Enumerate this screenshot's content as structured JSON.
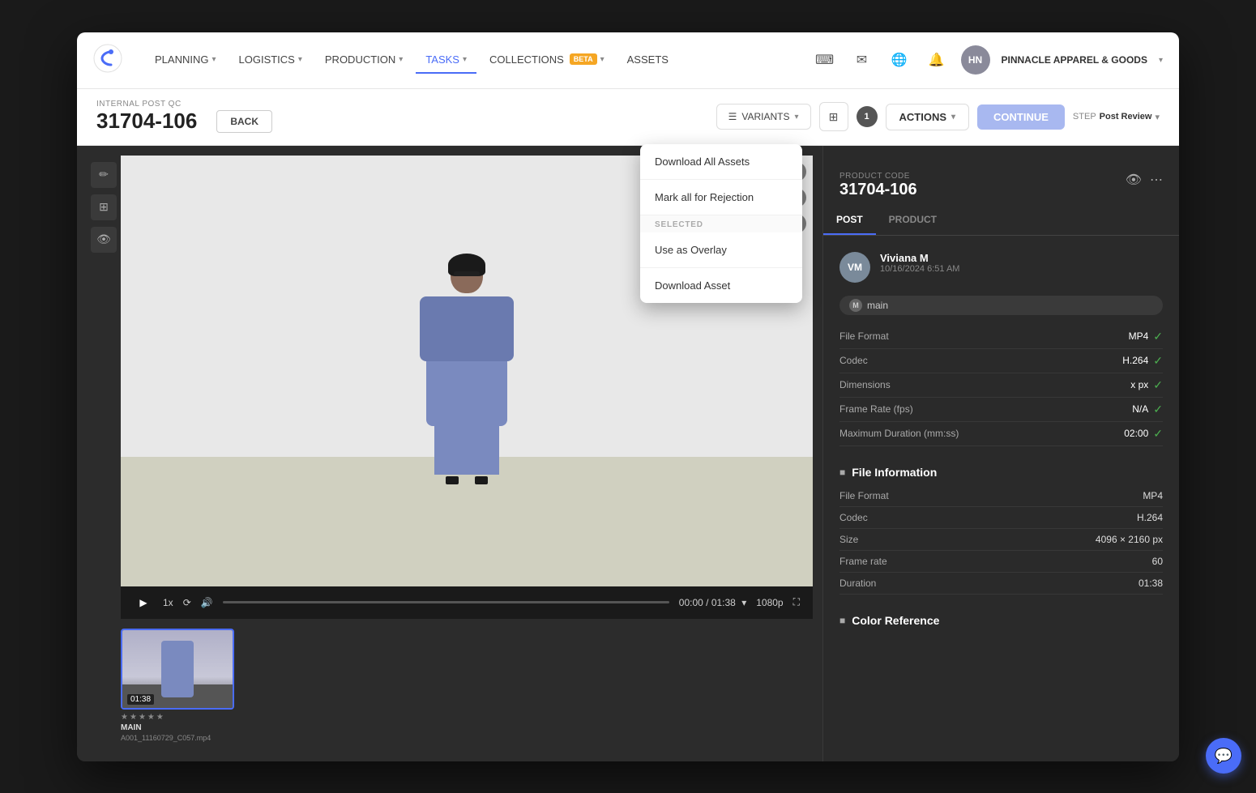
{
  "app": {
    "title": "Centric",
    "company": "PINNACLE APPAREL & GOODS"
  },
  "nav": {
    "items": [
      {
        "id": "planning",
        "label": "PLANNING",
        "hasChevron": true,
        "active": false
      },
      {
        "id": "logistics",
        "label": "LOGISTICS",
        "hasChevron": true,
        "active": false
      },
      {
        "id": "production",
        "label": "PRODUCTION",
        "hasChevron": true,
        "active": false
      },
      {
        "id": "tasks",
        "label": "TASKS",
        "hasChevron": true,
        "active": true
      },
      {
        "id": "collections",
        "label": "COLLECTIONS",
        "hasChevron": true,
        "active": false,
        "beta": true
      },
      {
        "id": "assets",
        "label": "ASSETS",
        "hasChevron": false,
        "active": false
      }
    ],
    "user_initials": "HN"
  },
  "subheader": {
    "label": "INTERNAL POST QC",
    "id": "31704-106",
    "back_label": "BACK",
    "variants_label": "VARIANTS",
    "actions_label": "ACTIONS",
    "continue_label": "CONTINUE",
    "step_label": "STEP",
    "step_value": "Post Review",
    "badge_count": "1"
  },
  "dropdown": {
    "items": [
      {
        "id": "download-all",
        "label": "Download All Assets",
        "is_divider": false
      },
      {
        "id": "mark-rejection",
        "label": "Mark all for Rejection",
        "is_divider": false
      },
      {
        "id": "selected-divider",
        "label": "SELECTED",
        "is_divider": true
      },
      {
        "id": "use-overlay",
        "label": "Use as Overlay",
        "is_divider": false
      },
      {
        "id": "download-asset",
        "label": "Download Asset",
        "is_divider": false
      }
    ]
  },
  "video_player": {
    "current_time": "00:00",
    "total_time": "01:38",
    "speed": "1x",
    "quality": "1080p"
  },
  "thumbnail": {
    "duration": "01:38",
    "label": "MAIN",
    "filename": "A001_11160729_C057.mp4",
    "stars": [
      "★",
      "★",
      "★",
      "★",
      "★"
    ]
  },
  "right_panel": {
    "product_code_label": "PRODUCT CODE",
    "product_code": "31704-106",
    "tabs": [
      {
        "id": "post",
        "label": "POST",
        "active": true
      },
      {
        "id": "product",
        "label": "PRODUCT",
        "active": false
      }
    ],
    "uploader": {
      "initials": "VM",
      "name": "Viviana M",
      "time": "10/16/2024 6:51 AM"
    },
    "main_badge": "main",
    "specs": [
      {
        "label": "File Format",
        "value": "MP4",
        "check": true
      },
      {
        "label": "Codec",
        "value": "H.264",
        "check": true
      },
      {
        "label": "Dimensions",
        "value": "x px",
        "check": true
      },
      {
        "label": "Frame Rate (fps)",
        "value": "N/A",
        "check": true
      },
      {
        "label": "Maximum Duration (mm:ss)",
        "value": "02:00",
        "check": true
      }
    ],
    "file_info_title": "File Information",
    "file_info": [
      {
        "label": "File Format",
        "value": "MP4"
      },
      {
        "label": "Codec",
        "value": "H.264"
      },
      {
        "label": "Size",
        "value": "4096 × 2160 px"
      },
      {
        "label": "Frame rate",
        "value": "60"
      },
      {
        "label": "Duration",
        "value": "01:38"
      }
    ],
    "color_ref_title": "Color Reference"
  }
}
